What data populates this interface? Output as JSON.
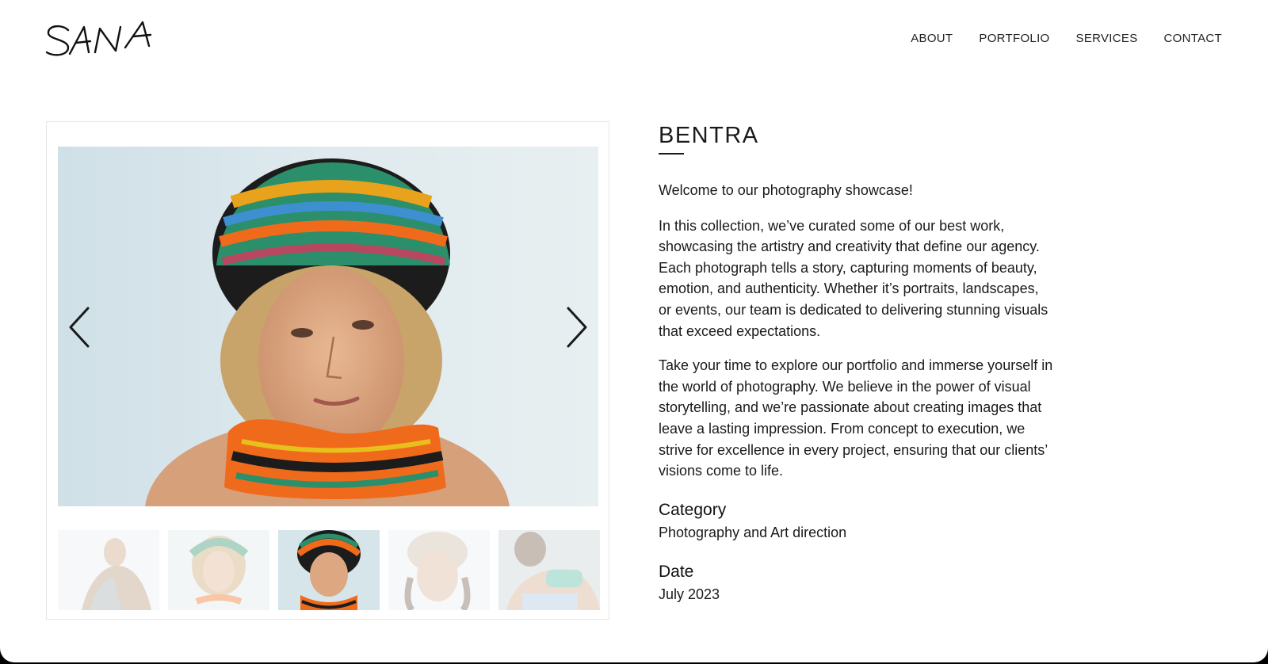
{
  "header": {
    "logo_text": "SANA",
    "nav": [
      "ABOUT",
      "PORTFOLIO",
      "SERVICES",
      "CONTACT"
    ]
  },
  "gallery": {
    "prev_icon": "chevron-left-icon",
    "next_icon": "chevron-right-icon",
    "active_thumb_index": 2,
    "thumb_count": 5
  },
  "project": {
    "title": "BENTRA",
    "intro": "Welcome to our photography showcase!",
    "paragraphs": [
      "In this collection, we’ve curated some of our best work, showcasing the artistry and creativity that define our agency. Each photograph tells a story, capturing moments of beauty, emotion, and authenticity. Whether it’s portraits, landscapes, or events, our team is dedicated to delivering stunning visuals that exceed expectations.",
      "Take your time to explore our portfolio and immerse yourself in the world of photography. We believe in the power of visual storytelling, and we’re passionate about creating images that leave a lasting impression. From concept to execution, we strive for excellence in every project, ensuring that our clients’ visions come to life."
    ],
    "category_label": "Category",
    "category_value": "Photography and Art direction",
    "date_label": "Date",
    "date_value": "July 2023"
  },
  "colors": {
    "text": "#1a1a1a",
    "background": "#ffffff",
    "photo_backdrop": "#d8e6ea"
  }
}
